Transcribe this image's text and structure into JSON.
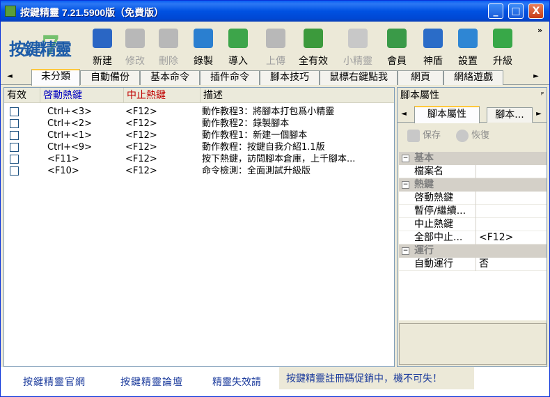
{
  "window": {
    "title": "按鍵精靈 7.21.5900版（免費版）",
    "controls": {
      "minimize": "_",
      "maximize": "□",
      "close": "X"
    }
  },
  "logo": {
    "text": "按鍵精靈",
    "mark": "7"
  },
  "toolbar": {
    "items": [
      {
        "label": "新建",
        "icon": "new-script-icon",
        "enabled": true,
        "color": "#2A66C4"
      },
      {
        "label": "修改",
        "icon": "edit-icon",
        "enabled": false,
        "color": "#B8B8B8"
      },
      {
        "label": "刪除",
        "icon": "delete-icon",
        "enabled": false,
        "color": "#B8B8B8"
      },
      {
        "label": "錄製",
        "icon": "record-icon",
        "enabled": true,
        "color": "#2A7FD0"
      },
      {
        "label": "導入",
        "icon": "import-icon",
        "enabled": true,
        "color": "#3DA54A"
      },
      {
        "label": "上傳",
        "icon": "upload-icon",
        "enabled": false,
        "color": "#B8B8B8"
      },
      {
        "label": "全有效",
        "icon": "enable-all-icon",
        "enabled": true,
        "color": "#3C9A3C"
      },
      {
        "label": "小精靈",
        "icon": "wizard-icon",
        "enabled": false,
        "color": "#C8C8C8"
      },
      {
        "label": "會員",
        "icon": "member-icon",
        "enabled": true,
        "color": "#3A9A48"
      },
      {
        "label": "神盾",
        "icon": "shield-icon",
        "enabled": true,
        "color": "#2A6CC8"
      },
      {
        "label": "設置",
        "icon": "settings-icon",
        "enabled": true,
        "color": "#2E86D4"
      },
      {
        "label": "升級",
        "icon": "upgrade-icon",
        "enabled": true,
        "color": "#38A848"
      }
    ],
    "more": "»"
  },
  "tabs": {
    "left_arrow": "◄",
    "right_arrow": "►",
    "items": [
      {
        "label": "未分類",
        "active": true
      },
      {
        "label": "自動備份",
        "active": false
      },
      {
        "label": "基本命令",
        "active": false
      },
      {
        "label": "插件命令",
        "active": false
      },
      {
        "label": "腳本技巧",
        "active": false
      },
      {
        "label": "鼠標右鍵點我",
        "active": false
      },
      {
        "label": "網頁",
        "active": false
      },
      {
        "label": "網絡遊戲",
        "active": false
      }
    ]
  },
  "list": {
    "columns": {
      "enabled": "有效",
      "start": "啓動熱鍵",
      "stop": "中止熱鍵",
      "desc": "描述"
    },
    "column_colors": {
      "start": "#0000C0",
      "stop": "#C00000"
    },
    "rows": [
      {
        "start": "Ctrl+<3>",
        "stop": "<F12>",
        "desc": "動作教程3：將腳本打包爲小精靈"
      },
      {
        "start": "Ctrl+<2>",
        "stop": "<F12>",
        "desc": "動作教程2：錄製腳本"
      },
      {
        "start": "Ctrl+<1>",
        "stop": "<F12>",
        "desc": "動作教程1：新建一個腳本"
      },
      {
        "start": "Ctrl+<9>",
        "stop": "<F12>",
        "desc": "動作教程：按鍵自我介紹1.1版"
      },
      {
        "start": "<F11>",
        "stop": "<F12>",
        "desc": "按下熱鍵，訪問腳本倉庫，上千腳本..."
      },
      {
        "start": "<F10>",
        "stop": "<F12>",
        "desc": "命令檢測：全面測試升級版"
      }
    ]
  },
  "properties": {
    "title": "腳本屬性",
    "pin": "ᴾ",
    "tabs": {
      "left_arrow": "◄",
      "right_arrow": "►",
      "items": [
        "腳本屬性",
        "腳本..."
      ]
    },
    "buttons": {
      "save": "保存",
      "restore": "恢復"
    },
    "categories": [
      {
        "name": "基本",
        "toggle": "⊟",
        "props": [
          {
            "key": "檔案名",
            "value": ""
          }
        ]
      },
      {
        "name": "熱鍵",
        "toggle": "⊟",
        "props": [
          {
            "key": "啓動熱鍵",
            "value": ""
          },
          {
            "key": "暫停/繼續...",
            "value": ""
          },
          {
            "key": "中止熱鍵",
            "value": ""
          },
          {
            "key": "全部中止...",
            "value": "<F12>"
          }
        ]
      },
      {
        "name": "運行",
        "toggle": "⊟",
        "props": [
          {
            "key": "自動運行",
            "value": "否"
          }
        ]
      }
    ]
  },
  "statusbar": {
    "links": [
      "按鍵精靈官網",
      "按鍵精靈論壇",
      "精靈失效請"
    ],
    "promo": "按鍵精靈註冊碼促銷中，機不可失！"
  }
}
